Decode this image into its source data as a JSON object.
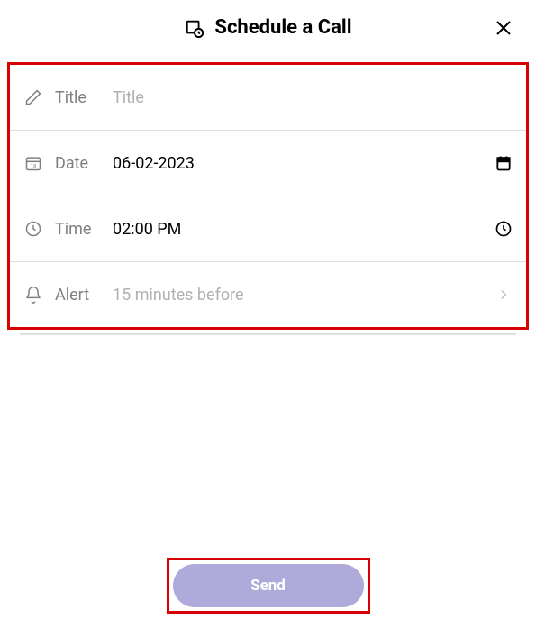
{
  "header": {
    "title": "Schedule a Call"
  },
  "form": {
    "title": {
      "label": "Title",
      "value": "",
      "placeholder": "Title"
    },
    "date": {
      "label": "Date",
      "value": "06-02-2023"
    },
    "time": {
      "label": "Time",
      "value": "02:00 PM"
    },
    "alert": {
      "label": "Alert",
      "value": "15 minutes before"
    }
  },
  "actions": {
    "send_label": "Send"
  }
}
